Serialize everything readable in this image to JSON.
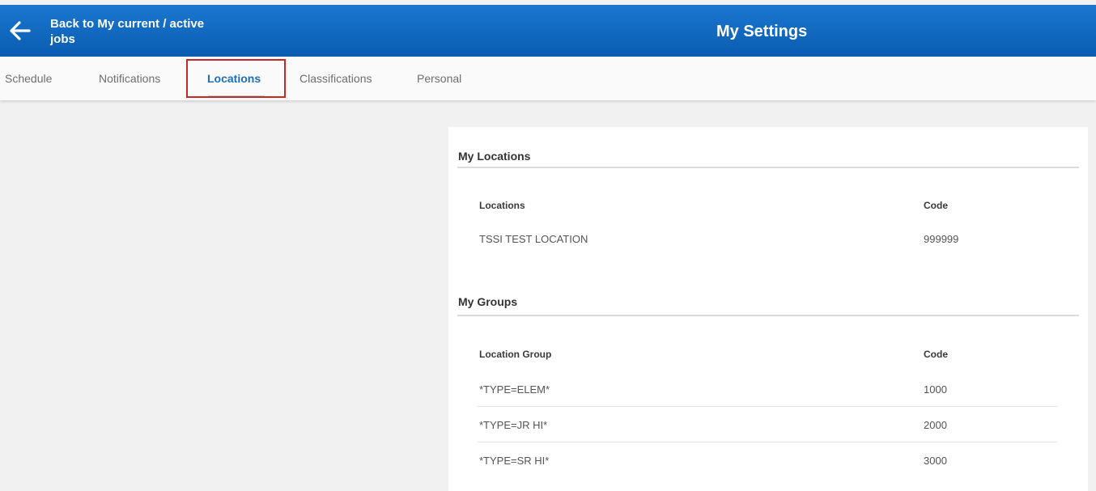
{
  "header": {
    "back_label": "Back to My current / active jobs",
    "title": "My Settings",
    "back_icon": "arrow-left-icon"
  },
  "tabs": [
    {
      "label": "Schedule"
    },
    {
      "label": "Notifications"
    },
    {
      "label": "Locations",
      "active": true
    },
    {
      "label": "Classifications"
    },
    {
      "label": "Personal"
    }
  ],
  "my_locations": {
    "title": "My Locations",
    "columns": [
      "Locations",
      "Code"
    ],
    "rows": [
      {
        "name": "TSSI TEST LOCATION",
        "code": "999999"
      }
    ]
  },
  "my_groups": {
    "title": "My Groups",
    "columns": [
      "Location Group",
      "Code"
    ],
    "rows": [
      {
        "name": "*TYPE=ELEM*",
        "code": "1000"
      },
      {
        "name": "*TYPE=JR HI*",
        "code": "2000"
      },
      {
        "name": "*TYPE=SR HI*",
        "code": "3000"
      }
    ]
  },
  "colors": {
    "header": "#0a5cb0",
    "active_tab": "#1b6fb8",
    "highlight": "#c62828"
  }
}
